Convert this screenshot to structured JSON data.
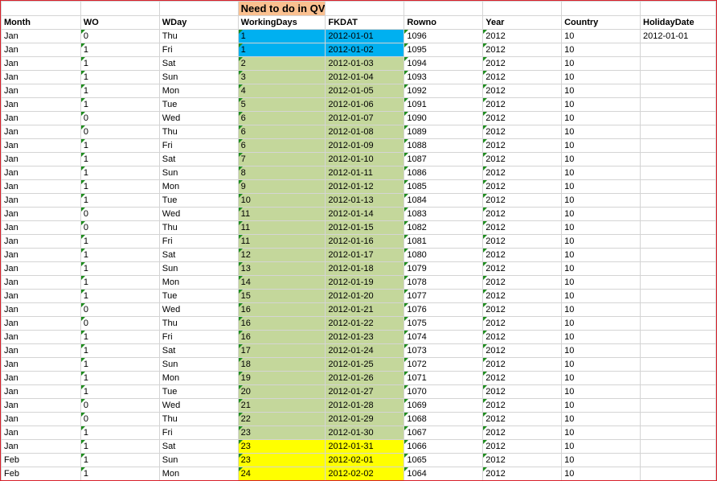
{
  "banner": "Need to do in QV",
  "colors": {
    "banner": "#fac090",
    "blue": "#00b0f0",
    "green": "#c4d79b",
    "yellow": "#ffff00",
    "border": "#d8202a"
  },
  "headers": [
    "Month",
    "WO",
    "WDay",
    "WorkingDays",
    "FKDAT",
    "Rowno",
    "Year",
    "Country",
    "HolidayDate"
  ],
  "rows": [
    {
      "month": "Jan",
      "wo": "0",
      "wday": "Thu",
      "wd": "1",
      "fkdat": "2012-01-01",
      "rowno": "1096",
      "year": "2012",
      "country": "10",
      "holiday": "2012-01-01",
      "hl": "blue"
    },
    {
      "month": "Jan",
      "wo": "1",
      "wday": "Fri",
      "wd": "1",
      "fkdat": "2012-01-02",
      "rowno": "1095",
      "year": "2012",
      "country": "10",
      "holiday": "",
      "hl": "blue"
    },
    {
      "month": "Jan",
      "wo": "1",
      "wday": "Sat",
      "wd": "2",
      "fkdat": "2012-01-03",
      "rowno": "1094",
      "year": "2012",
      "country": "10",
      "holiday": "",
      "hl": "green"
    },
    {
      "month": "Jan",
      "wo": "1",
      "wday": "Sun",
      "wd": "3",
      "fkdat": "2012-01-04",
      "rowno": "1093",
      "year": "2012",
      "country": "10",
      "holiday": "",
      "hl": "green"
    },
    {
      "month": "Jan",
      "wo": "1",
      "wday": "Mon",
      "wd": "4",
      "fkdat": "2012-01-05",
      "rowno": "1092",
      "year": "2012",
      "country": "10",
      "holiday": "",
      "hl": "green"
    },
    {
      "month": "Jan",
      "wo": "1",
      "wday": "Tue",
      "wd": "5",
      "fkdat": "2012-01-06",
      "rowno": "1091",
      "year": "2012",
      "country": "10",
      "holiday": "",
      "hl": "green"
    },
    {
      "month": "Jan",
      "wo": "0",
      "wday": "Wed",
      "wd": "6",
      "fkdat": "2012-01-07",
      "rowno": "1090",
      "year": "2012",
      "country": "10",
      "holiday": "",
      "hl": "green"
    },
    {
      "month": "Jan",
      "wo": "0",
      "wday": "Thu",
      "wd": "6",
      "fkdat": "2012-01-08",
      "rowno": "1089",
      "year": "2012",
      "country": "10",
      "holiday": "",
      "hl": "green"
    },
    {
      "month": "Jan",
      "wo": "1",
      "wday": "Fri",
      "wd": "6",
      "fkdat": "2012-01-09",
      "rowno": "1088",
      "year": "2012",
      "country": "10",
      "holiday": "",
      "hl": "green"
    },
    {
      "month": "Jan",
      "wo": "1",
      "wday": "Sat",
      "wd": "7",
      "fkdat": "2012-01-10",
      "rowno": "1087",
      "year": "2012",
      "country": "10",
      "holiday": "",
      "hl": "green"
    },
    {
      "month": "Jan",
      "wo": "1",
      "wday": "Sun",
      "wd": "8",
      "fkdat": "2012-01-11",
      "rowno": "1086",
      "year": "2012",
      "country": "10",
      "holiday": "",
      "hl": "green"
    },
    {
      "month": "Jan",
      "wo": "1",
      "wday": "Mon",
      "wd": "9",
      "fkdat": "2012-01-12",
      "rowno": "1085",
      "year": "2012",
      "country": "10",
      "holiday": "",
      "hl": "green"
    },
    {
      "month": "Jan",
      "wo": "1",
      "wday": "Tue",
      "wd": "10",
      "fkdat": "2012-01-13",
      "rowno": "1084",
      "year": "2012",
      "country": "10",
      "holiday": "",
      "hl": "green"
    },
    {
      "month": "Jan",
      "wo": "0",
      "wday": "Wed",
      "wd": "11",
      "fkdat": "2012-01-14",
      "rowno": "1083",
      "year": "2012",
      "country": "10",
      "holiday": "",
      "hl": "green"
    },
    {
      "month": "Jan",
      "wo": "0",
      "wday": "Thu",
      "wd": "11",
      "fkdat": "2012-01-15",
      "rowno": "1082",
      "year": "2012",
      "country": "10",
      "holiday": "",
      "hl": "green"
    },
    {
      "month": "Jan",
      "wo": "1",
      "wday": "Fri",
      "wd": "11",
      "fkdat": "2012-01-16",
      "rowno": "1081",
      "year": "2012",
      "country": "10",
      "holiday": "",
      "hl": "green"
    },
    {
      "month": "Jan",
      "wo": "1",
      "wday": "Sat",
      "wd": "12",
      "fkdat": "2012-01-17",
      "rowno": "1080",
      "year": "2012",
      "country": "10",
      "holiday": "",
      "hl": "green"
    },
    {
      "month": "Jan",
      "wo": "1",
      "wday": "Sun",
      "wd": "13",
      "fkdat": "2012-01-18",
      "rowno": "1079",
      "year": "2012",
      "country": "10",
      "holiday": "",
      "hl": "green"
    },
    {
      "month": "Jan",
      "wo": "1",
      "wday": "Mon",
      "wd": "14",
      "fkdat": "2012-01-19",
      "rowno": "1078",
      "year": "2012",
      "country": "10",
      "holiday": "",
      "hl": "green"
    },
    {
      "month": "Jan",
      "wo": "1",
      "wday": "Tue",
      "wd": "15",
      "fkdat": "2012-01-20",
      "rowno": "1077",
      "year": "2012",
      "country": "10",
      "holiday": "",
      "hl": "green"
    },
    {
      "month": "Jan",
      "wo": "0",
      "wday": "Wed",
      "wd": "16",
      "fkdat": "2012-01-21",
      "rowno": "1076",
      "year": "2012",
      "country": "10",
      "holiday": "",
      "hl": "green"
    },
    {
      "month": "Jan",
      "wo": "0",
      "wday": "Thu",
      "wd": "16",
      "fkdat": "2012-01-22",
      "rowno": "1075",
      "year": "2012",
      "country": "10",
      "holiday": "",
      "hl": "green"
    },
    {
      "month": "Jan",
      "wo": "1",
      "wday": "Fri",
      "wd": "16",
      "fkdat": "2012-01-23",
      "rowno": "1074",
      "year": "2012",
      "country": "10",
      "holiday": "",
      "hl": "green"
    },
    {
      "month": "Jan",
      "wo": "1",
      "wday": "Sat",
      "wd": "17",
      "fkdat": "2012-01-24",
      "rowno": "1073",
      "year": "2012",
      "country": "10",
      "holiday": "",
      "hl": "green"
    },
    {
      "month": "Jan",
      "wo": "1",
      "wday": "Sun",
      "wd": "18",
      "fkdat": "2012-01-25",
      "rowno": "1072",
      "year": "2012",
      "country": "10",
      "holiday": "",
      "hl": "green"
    },
    {
      "month": "Jan",
      "wo": "1",
      "wday": "Mon",
      "wd": "19",
      "fkdat": "2012-01-26",
      "rowno": "1071",
      "year": "2012",
      "country": "10",
      "holiday": "",
      "hl": "green"
    },
    {
      "month": "Jan",
      "wo": "1",
      "wday": "Tue",
      "wd": "20",
      "fkdat": "2012-01-27",
      "rowno": "1070",
      "year": "2012",
      "country": "10",
      "holiday": "",
      "hl": "green"
    },
    {
      "month": "Jan",
      "wo": "0",
      "wday": "Wed",
      "wd": "21",
      "fkdat": "2012-01-28",
      "rowno": "1069",
      "year": "2012",
      "country": "10",
      "holiday": "",
      "hl": "green"
    },
    {
      "month": "Jan",
      "wo": "0",
      "wday": "Thu",
      "wd": "22",
      "fkdat": "2012-01-29",
      "rowno": "1068",
      "year": "2012",
      "country": "10",
      "holiday": "",
      "hl": "green"
    },
    {
      "month": "Jan",
      "wo": "1",
      "wday": "Fri",
      "wd": "23",
      "fkdat": "2012-01-30",
      "rowno": "1067",
      "year": "2012",
      "country": "10",
      "holiday": "",
      "hl": "green"
    },
    {
      "month": "Jan",
      "wo": "1",
      "wday": "Sat",
      "wd": "23",
      "fkdat": "2012-01-31",
      "rowno": "1066",
      "year": "2012",
      "country": "10",
      "holiday": "",
      "hl": "yellow"
    },
    {
      "month": "Feb",
      "wo": "1",
      "wday": "Sun",
      "wd": "23",
      "fkdat": "2012-02-01",
      "rowno": "1065",
      "year": "2012",
      "country": "10",
      "holiday": "",
      "hl": "yellow"
    },
    {
      "month": "Feb",
      "wo": "1",
      "wday": "Mon",
      "wd": "24",
      "fkdat": "2012-02-02",
      "rowno": "1064",
      "year": "2012",
      "country": "10",
      "holiday": "",
      "hl": "yellow"
    }
  ]
}
